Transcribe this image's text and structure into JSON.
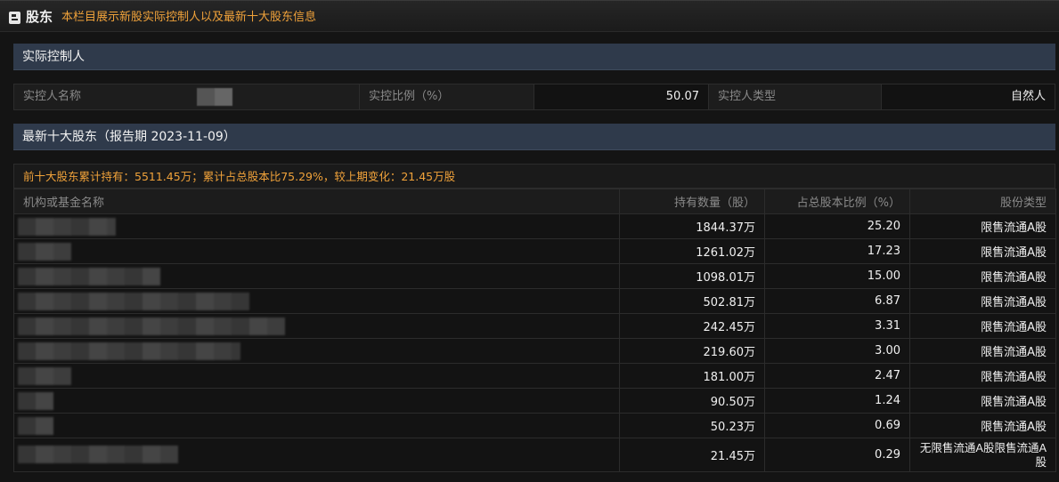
{
  "header": {
    "icon": "document-icon",
    "title": "股东",
    "description": "本栏目展示新股实际控制人以及最新十大股东信息"
  },
  "controller": {
    "section_title": "实际控制人",
    "name_label": "实控人名称",
    "ratio_label": "实控比例（%）",
    "ratio_value": "50.07",
    "type_label": "实控人类型",
    "type_value": "自然人"
  },
  "top_holders": {
    "section_title": "最新十大股东（报告期 2023-11-09）",
    "summary": "前十大股东累计持有：5511.45万；累计占总股本比75.29%，较上期变化：21.45万股",
    "columns": [
      "机构或基金名称",
      "持有数量（股）",
      "占总股本比例（%）",
      "股份类型"
    ],
    "rows": [
      {
        "qty": "1844.37万",
        "pct": "25.20",
        "type": "限售流通A股"
      },
      {
        "qty": "1261.02万",
        "pct": "17.23",
        "type": "限售流通A股"
      },
      {
        "qty": "1098.01万",
        "pct": "15.00",
        "type": "限售流通A股"
      },
      {
        "qty": "502.81万",
        "pct": "6.87",
        "type": "限售流通A股"
      },
      {
        "qty": "242.45万",
        "pct": "3.31",
        "type": "限售流通A股"
      },
      {
        "qty": "219.60万",
        "pct": "3.00",
        "type": "限售流通A股"
      },
      {
        "qty": "181.00万",
        "pct": "2.47",
        "type": "限售流通A股"
      },
      {
        "qty": "90.50万",
        "pct": "1.24",
        "type": "限售流通A股"
      },
      {
        "qty": "50.23万",
        "pct": "0.69",
        "type": "限售流通A股"
      },
      {
        "qty": "21.45万",
        "pct": "0.29",
        "type": "无限售流通A股限售流通A股"
      }
    ]
  }
}
